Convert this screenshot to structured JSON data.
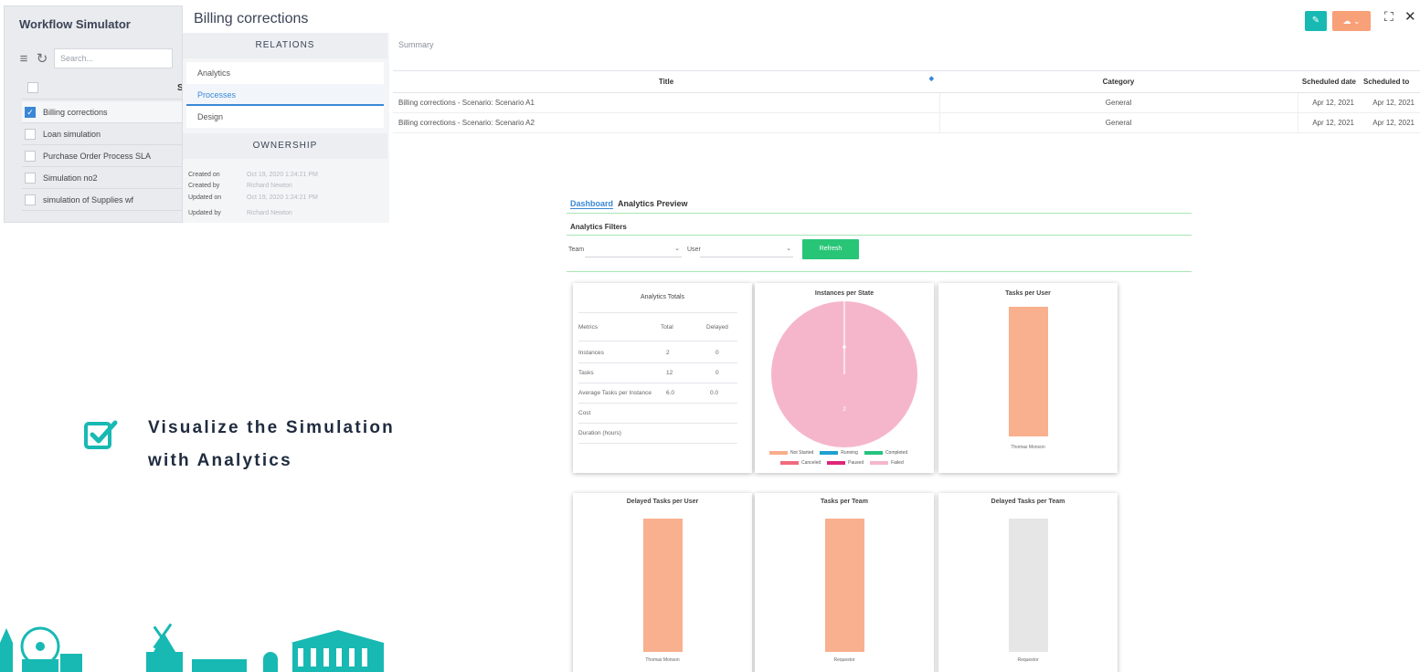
{
  "workflow_panel": {
    "title": "Workflow Simulator",
    "search_placeholder": "Search...",
    "column_header_letter": "S",
    "items": [
      {
        "label": "Billing corrections",
        "checked": true
      },
      {
        "label": "Loan simulation",
        "checked": false
      },
      {
        "label": "Purchase Order Process SLA",
        "checked": false
      },
      {
        "label": "Simulation no2",
        "checked": false
      },
      {
        "label": "simulation of Supplies wf",
        "checked": false
      }
    ]
  },
  "relations": {
    "page_title": "Billing corrections",
    "heading": "RELATIONS",
    "items": [
      "Analytics",
      "Processes",
      "Design"
    ],
    "active_item": "Processes",
    "ownership_heading": "OWNERSHIP",
    "ownership": [
      {
        "key": "Created on",
        "value": "Oct 19, 2020 1:24:21 PM"
      },
      {
        "key": "Created by",
        "value": "Richard Newton"
      },
      {
        "key": "Updated on",
        "value": "Oct 19, 2020 1:24:21 PM"
      },
      {
        "key": "Updated by",
        "value": "Richard Newton"
      }
    ]
  },
  "summary": {
    "label": "Summary",
    "columns": [
      "Title",
      "Category",
      "Scheduled date",
      "Scheduled to"
    ],
    "rows": [
      [
        "Billing corrections - Scenario: Scenario A1",
        "General",
        "Apr 12, 2021",
        "Apr 12, 2021"
      ],
      [
        "Billing corrections - Scenario: Scenario A2",
        "General",
        "Apr 12, 2021",
        "Apr 12, 2021"
      ]
    ]
  },
  "toolbar": {
    "edit_icon": "pencil-icon",
    "cloud_icon": "cloud-icon",
    "colors": {
      "edit": "#18b9b3",
      "cloud": "#f8a077"
    }
  },
  "headline": {
    "line1": "Visualize the Simulation",
    "line2": "with Analytics",
    "icon": "checkbox-check-icon",
    "icon_color": "#18b9b3"
  },
  "dashboard": {
    "tabs": [
      "Dashboard",
      "Analytics Preview"
    ],
    "active_tab": "Dashboard",
    "filters_title": "Analytics Filters",
    "team_label": "Team",
    "user_label": "User",
    "refresh_label": "Refresh",
    "totals": {
      "title": "Analytics Totals",
      "headers": [
        "Metrics",
        "Total",
        "Delayed"
      ],
      "rows": [
        [
          "Instances",
          "2",
          "0"
        ],
        [
          "Tasks",
          "12",
          "0"
        ],
        [
          "Average Tasks per Instance",
          "6.0",
          "0.0"
        ],
        [
          "Cost",
          "",
          ""
        ],
        [
          "Duration (hours)",
          "",
          ""
        ]
      ]
    },
    "pie_card": {
      "title": "Instances per State",
      "slice_label": "2",
      "legend": [
        {
          "label": "Not Started",
          "color": "#f8ae8a"
        },
        {
          "label": "Running",
          "color": "#1f9fd1"
        },
        {
          "label": "Completed",
          "color": "#26c281"
        },
        {
          "label": "Canceled",
          "color": "#f06a7e"
        },
        {
          "label": "Paused",
          "color": "#e0257a"
        },
        {
          "label": "Failed",
          "color": "#f5b6cc"
        }
      ]
    },
    "bar_cards": [
      {
        "title": "Tasks per User",
        "label": "Thomas Monson"
      },
      {
        "title": "Delayed Tasks per User",
        "label": "Thomas Monson"
      },
      {
        "title": "Tasks per Team",
        "label": "Requestor"
      },
      {
        "title": "Delayed Tasks per Team",
        "label": "Requestor"
      }
    ]
  },
  "chart_data": [
    {
      "type": "pie",
      "title": "Instances per State",
      "categories": [
        "Not Started",
        "Running",
        "Completed",
        "Canceled",
        "Paused",
        "Failed"
      ],
      "values": [
        0,
        0,
        0,
        0,
        0,
        2
      ],
      "data_labels": [
        "2"
      ],
      "legend": "bottom"
    },
    {
      "type": "bar",
      "title": "Tasks per User",
      "categories": [
        "Thomas Monson"
      ],
      "values": [
        12
      ],
      "color": "#f8b08e"
    },
    {
      "type": "bar",
      "title": "Delayed Tasks per User",
      "categories": [
        "Thomas Monson"
      ],
      "values": [
        12
      ],
      "color": "#f8b08e"
    },
    {
      "type": "bar",
      "title": "Tasks per Team",
      "categories": [
        "Requestor"
      ],
      "values": [
        12
      ],
      "color": "#f8b08e"
    },
    {
      "type": "bar",
      "title": "Delayed Tasks per Team",
      "categories": [
        "Requestor"
      ],
      "values": [
        12
      ],
      "color": "#e6e6e6"
    }
  ]
}
